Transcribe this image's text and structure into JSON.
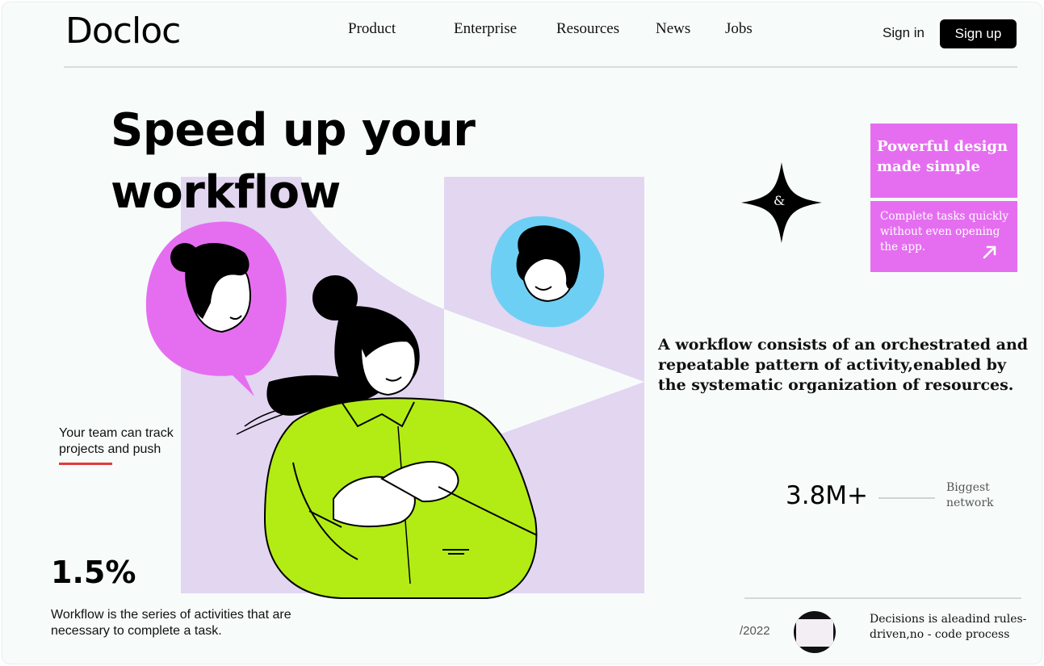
{
  "nav": {
    "logo": "Docloc",
    "links": [
      "Product",
      "Enterprise",
      "Resources",
      "News",
      "Jobs"
    ],
    "sign_in": "Sign in",
    "sign_up": "Sign up"
  },
  "hero": {
    "title": "Speed up your workflow"
  },
  "card": {
    "title": "Powerful design made simple",
    "text": "Complete tasks quickly without even opening the app.",
    "arrow_icon": "arrow-up-right-icon"
  },
  "star": {
    "symbol": "&"
  },
  "description": "A workflow consists of an orchestrated and repeatable pattern of activity,enabled by the systematic  organization of resources.",
  "stat_right": {
    "value": "3.8M+",
    "label_line1": "Biggest",
    "label_line2": "network"
  },
  "track": {
    "text": "Your team can track projects and push"
  },
  "stat_left": {
    "value": "1.5%",
    "desc": "Workflow is the series of activities that are necessary to complete a task."
  },
  "footer": {
    "year": "/2022",
    "decision_text": "Decisions is aleadind rules-driven,no - code process"
  },
  "colors": {
    "pink": "#e56ef0",
    "lavender": "#e2d6f1",
    "lime": "#b2ec14",
    "sky": "#6ecff4",
    "accent_red": "#e23a3a"
  }
}
